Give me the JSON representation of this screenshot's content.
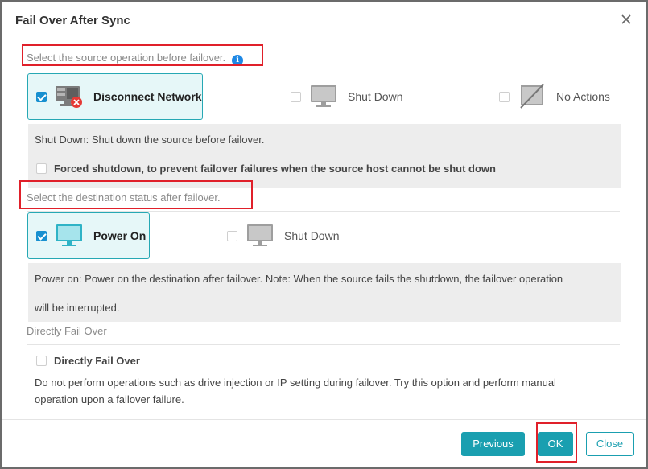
{
  "dialog": {
    "title": "Fail Over After Sync"
  },
  "source": {
    "label": "Select the source operation before failover.",
    "options": [
      {
        "label": "Disconnect Network",
        "selected": true,
        "icon": "network-disconnect-icon"
      },
      {
        "label": "Shut Down",
        "selected": false,
        "icon": "monitor-off-icon"
      },
      {
        "label": "No Actions",
        "selected": false,
        "icon": "no-action-icon"
      }
    ],
    "description": "Shut Down: Shut down the source before failover.",
    "forced_label": "Forced shutdown, to prevent failover failures when the source host cannot be shut down"
  },
  "destination": {
    "label": "Select the destination status after failover.",
    "options": [
      {
        "label": "Power On",
        "selected": true,
        "icon": "monitor-on-icon"
      },
      {
        "label": "Shut Down",
        "selected": false,
        "icon": "monitor-off-icon"
      }
    ],
    "description_line1": "Power on: Power on the destination after failover. Note: When the source fails the shutdown, the failover operation",
    "description_line2": "will be interrupted."
  },
  "direct": {
    "label": "Directly Fail Over",
    "checkbox_label": "Directly Fail Over",
    "description_line1": "Do not perform operations such as drive injection or IP setting during failover. Try this option and perform manual",
    "description_line2": "operation upon a failover failure."
  },
  "footer": {
    "previous": "Previous",
    "ok": "OK",
    "close": "Close"
  },
  "colors": {
    "accent": "#1a9fb0",
    "highlight": "#e0202a",
    "checkbox": "#1890d0"
  }
}
